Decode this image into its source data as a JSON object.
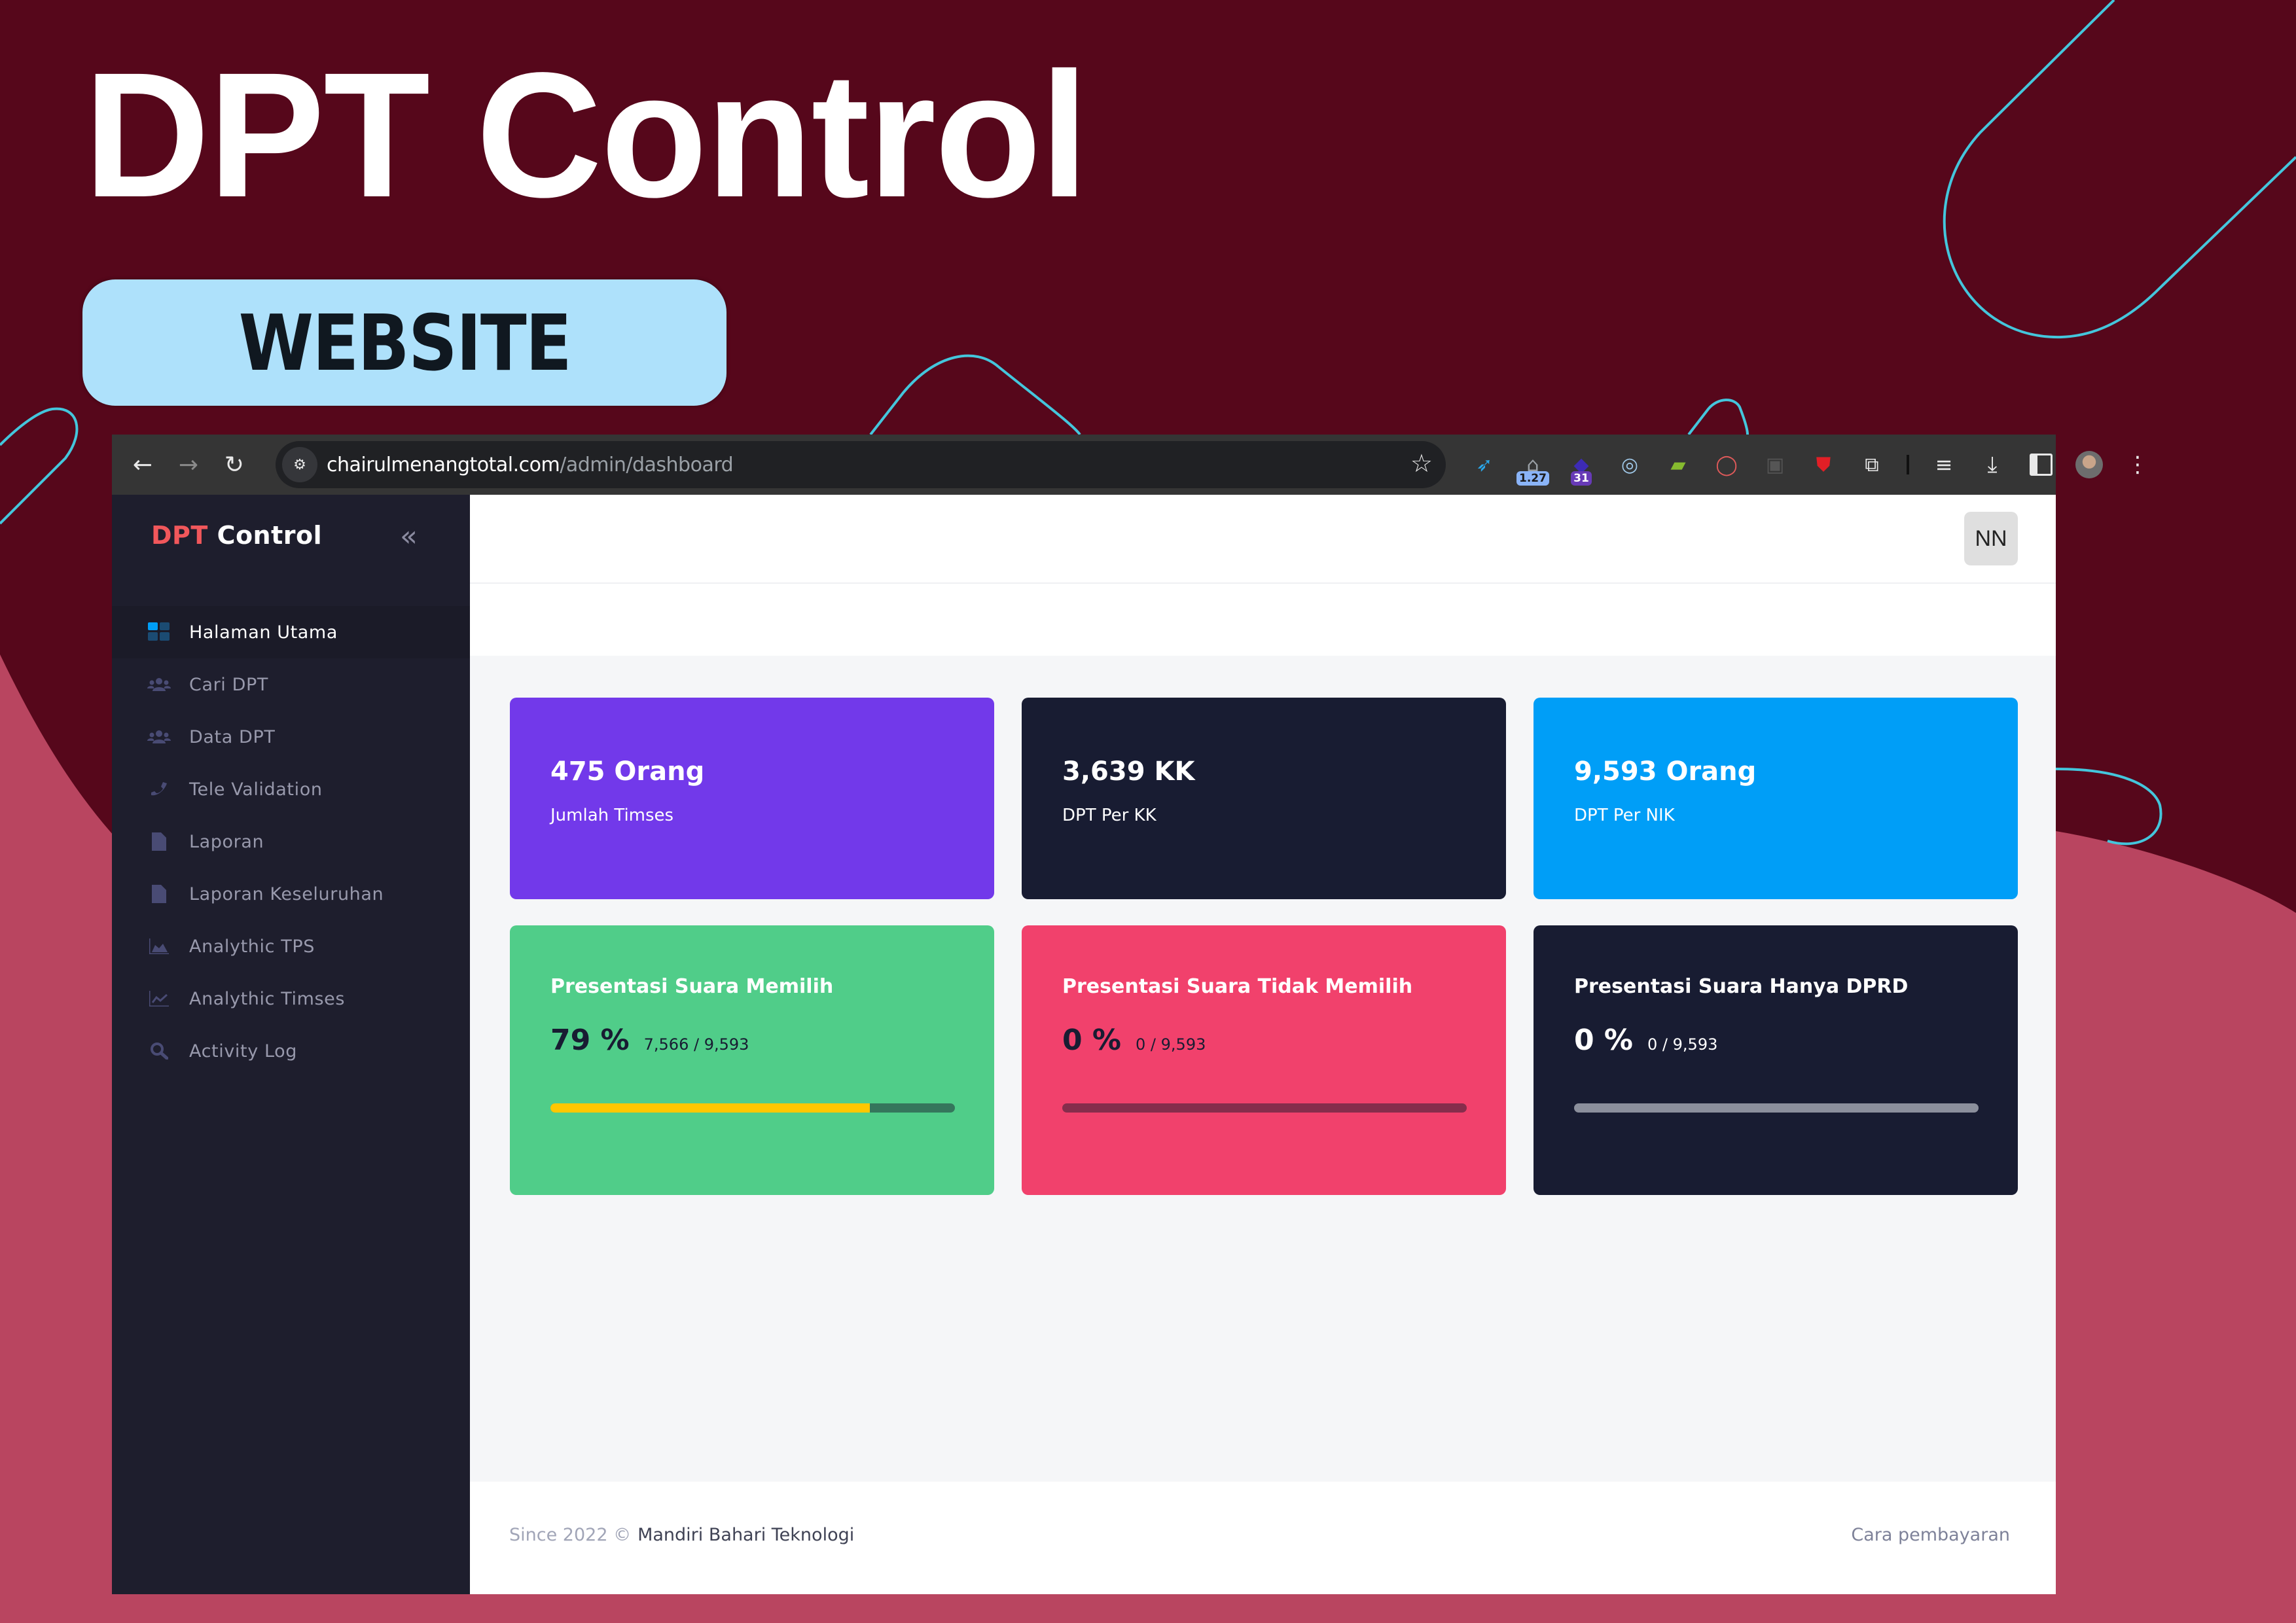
{
  "promo": {
    "title": "DPT Control",
    "badge": "WEBSITE"
  },
  "browser": {
    "url_host": "chairulmenangtotal.com",
    "url_path": "/admin/dashboard",
    "extensions": [
      {
        "name": "extension-arrow",
        "glyph": "➶",
        "color": "#2aa6e8",
        "badge": ""
      },
      {
        "name": "extension-counter",
        "glyph": "⌂",
        "color": "#9aa0a6",
        "badge": "1.27"
      },
      {
        "name": "extension-calendar",
        "glyph": "◆",
        "color": "#3d2bb5",
        "badge": "31"
      },
      {
        "name": "extension-ring",
        "glyph": "◎",
        "color": "#9fc8e8",
        "badge": ""
      },
      {
        "name": "extension-xml",
        "glyph": "▰",
        "color": "#86bb2f",
        "badge": ""
      },
      {
        "name": "extension-opera",
        "glyph": "◯",
        "color": "#e05a5a",
        "badge": ""
      },
      {
        "name": "extension-selenium",
        "glyph": "▣",
        "color": "#555555",
        "badge": ""
      },
      {
        "name": "extension-csp",
        "glyph": "⛊",
        "color": "#e21f26",
        "badge": ""
      },
      {
        "name": "extensions-puzzle",
        "glyph": "⧉",
        "color": "#e8e8e8",
        "badge": ""
      }
    ]
  },
  "sidebar": {
    "brand_red": "DPT",
    "brand_white": "Control",
    "collapse_glyph": "«",
    "items": [
      {
        "label": "Halaman Utama",
        "icon": "dashboard-icon",
        "active": true
      },
      {
        "label": "Cari DPT",
        "icon": "users-icon",
        "active": false
      },
      {
        "label": "Data DPT",
        "icon": "users-icon",
        "active": false
      },
      {
        "label": "Tele Validation",
        "icon": "phone-icon",
        "active": false
      },
      {
        "label": "Laporan",
        "icon": "file-icon",
        "active": false
      },
      {
        "label": "Laporan Keseluruhan",
        "icon": "file-icon",
        "active": false
      },
      {
        "label": "Analythic TPS",
        "icon": "area-chart-icon",
        "active": false
      },
      {
        "label": "Analythic Timses",
        "icon": "line-chart-icon",
        "active": false
      },
      {
        "label": "Activity Log",
        "icon": "search-icon",
        "active": false
      }
    ]
  },
  "header": {
    "avatar_initials": "NN"
  },
  "stats": [
    {
      "value": "475 Orang",
      "label": "Jumlah Timses",
      "color": "#7239ea"
    },
    {
      "value": "3,639 KK",
      "label": "DPT Per KK",
      "color": "#181c32"
    },
    {
      "value": "9,593 Orang",
      "label": "DPT Per NIK",
      "color": "#009ef7"
    }
  ],
  "percentages": [
    {
      "title": "Presentasi Suara Memilih",
      "percent": "79 %",
      "ratio": "7,566 / 9,593",
      "progress": 0.79,
      "color": "#50cd89",
      "text_color": "#181c32",
      "track": "#35765c",
      "fill": "#ffc700"
    },
    {
      "title": "Presentasi Suara Tidak Memilih",
      "percent": "0 %",
      "ratio": "0 / 9,593",
      "progress": 0.0,
      "color": "#f1416c",
      "text_color": "#181c32",
      "track": "#862d4c",
      "fill": "#ffc700"
    },
    {
      "title": "Presentasi Suara Hanya DPRD",
      "percent": "0 %",
      "ratio": "0 / 9,593",
      "progress": 0.0,
      "color": "#181c32",
      "text_color": "#ffffff",
      "track": "#8b8f9c",
      "fill": "#ffc700"
    }
  ],
  "footer": {
    "since": "Since 2022 ©",
    "company": "Mandiri Bahari Teknologi",
    "link": "Cara pembayaran"
  }
}
